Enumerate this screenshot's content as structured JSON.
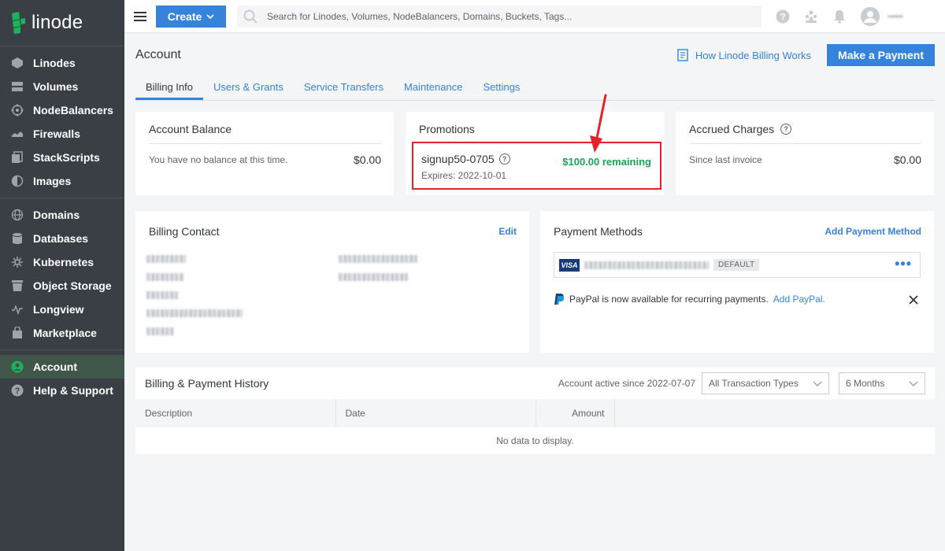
{
  "brand": {
    "name": "linode"
  },
  "sidebar": {
    "groups": [
      [
        {
          "label": "Linodes",
          "icon": "linodes-icon"
        },
        {
          "label": "Volumes",
          "icon": "volumes-icon"
        },
        {
          "label": "NodeBalancers",
          "icon": "nodebalancers-icon"
        },
        {
          "label": "Firewalls",
          "icon": "firewalls-icon"
        },
        {
          "label": "StackScripts",
          "icon": "stackscripts-icon"
        },
        {
          "label": "Images",
          "icon": "images-icon"
        }
      ],
      [
        {
          "label": "Domains",
          "icon": "domains-icon"
        },
        {
          "label": "Databases",
          "icon": "databases-icon"
        },
        {
          "label": "Kubernetes",
          "icon": "kubernetes-icon"
        },
        {
          "label": "Object Storage",
          "icon": "object-storage-icon"
        },
        {
          "label": "Longview",
          "icon": "longview-icon"
        },
        {
          "label": "Marketplace",
          "icon": "marketplace-icon"
        }
      ],
      [
        {
          "label": "Account",
          "icon": "account-icon",
          "active": true
        },
        {
          "label": "Help & Support",
          "icon": "help-icon"
        }
      ]
    ]
  },
  "topbar": {
    "create_label": "Create",
    "search_placeholder": "Search for Linodes, Volumes, NodeBalancers, Domains, Buckets, Tags...",
    "username": "••••••"
  },
  "page": {
    "title": "Account",
    "docs_link": "How Linode Billing Works",
    "pay_button": "Make a Payment",
    "tabs": [
      "Billing Info",
      "Users & Grants",
      "Service Transfers",
      "Maintenance",
      "Settings"
    ],
    "active_tab": 0
  },
  "balance": {
    "title": "Account Balance",
    "text": "You have no balance at this time.",
    "amount": "$0.00"
  },
  "promotions": {
    "title": "Promotions",
    "code": "signup50-0705",
    "remaining": "$100.00 remaining",
    "expires": "Expires: 2022-10-01"
  },
  "accrued": {
    "title": "Accrued Charges",
    "text": "Since last invoice",
    "amount": "$0.00"
  },
  "billing_contact": {
    "title": "Billing Contact",
    "edit": "Edit"
  },
  "payment_methods": {
    "title": "Payment Methods",
    "add": "Add Payment Method",
    "card_brand": "VISA",
    "default_badge": "DEFAULT",
    "paypal_text": "PayPal is now available for recurring payments.",
    "paypal_link": "Add PayPal."
  },
  "history": {
    "title": "Billing & Payment History",
    "active_since": "Account active since 2022-07-07",
    "type_select": "All Transaction Types",
    "period_select": "6 Months",
    "columns": [
      "Description",
      "Date",
      "Amount"
    ],
    "empty": "No data to display."
  },
  "colors": {
    "accent": "#3683dc",
    "success": "#17a653",
    "highlight": "#e3232a",
    "sidebar": "#3a3f46"
  }
}
